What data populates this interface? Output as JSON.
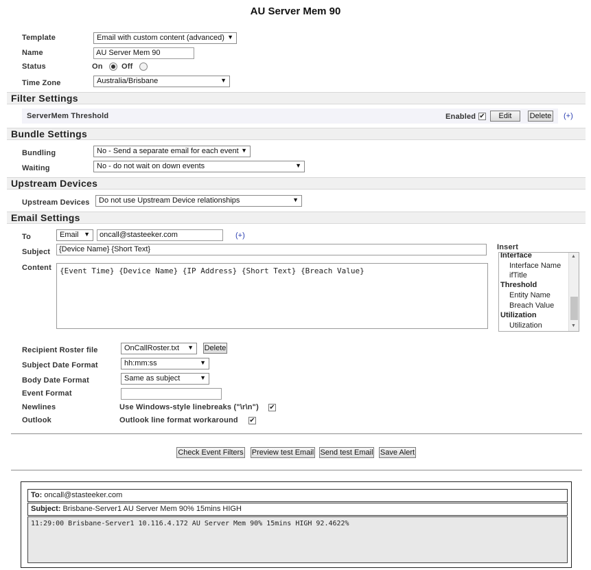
{
  "page_title": "AU Server Mem 90",
  "general": {
    "template_label": "Template",
    "template_value": "Email with custom content (advanced)",
    "name_label": "Name",
    "name_value": "AU Server Mem 90",
    "status_label": "Status",
    "status_on": "On",
    "status_off": "Off",
    "timezone_label": "Time Zone",
    "timezone_value": "Australia/Brisbane"
  },
  "filter_settings": {
    "heading": "Filter Settings",
    "filter_name": "ServerMem Threshold",
    "enabled_label": "Enabled",
    "enabled_mark": "✔",
    "edit_label": "Edit",
    "delete_label": "Delete",
    "add_label": "(+)"
  },
  "bundle_settings": {
    "heading": "Bundle Settings",
    "bundling_label": "Bundling",
    "bundling_value": "No - Send a separate email for each event",
    "waiting_label": "Waiting",
    "waiting_value": "No - do not wait on down events"
  },
  "upstream": {
    "heading": "Upstream Devices",
    "label": "Upstream Devices",
    "value": "Do not use Upstream Device relationships"
  },
  "email_settings": {
    "heading": "Email Settings",
    "to_label": "To",
    "to_type": "Email",
    "to_value": "oncall@stasteeker.com",
    "to_add": "(+)",
    "subject_label": "Subject",
    "subject_value": "{Device Name} {Short Text}",
    "content_label": "Content",
    "content_value": "{Event Time} {Device Name} {IP Address} {Short Text} {Breach Value}",
    "insert_label": "Insert",
    "insert_items": {
      "g1": "Interface",
      "i1": "Interface Name",
      "i2": "ifTitle",
      "g2": "Threshold",
      "i3": "Entity Name",
      "i4": "Breach Value",
      "g3": "Utilization",
      "i5": "Utilization"
    },
    "roster_label": "Recipient Roster file",
    "roster_value": "OnCallRoster.txt",
    "roster_delete": "Delete",
    "subject_date_label": "Subject Date Format",
    "subject_date_value": "hh:mm:ss",
    "body_date_label": "Body Date Format",
    "body_date_value": "Same as subject",
    "event_format_label": "Event Format",
    "event_format_value": "",
    "newlines_label": "Newlines",
    "newlines_text": "Use Windows-style linebreaks (\"\\r\\n\")",
    "newlines_mark": "✔",
    "outlook_label": "Outlook",
    "outlook_text": "Outlook line format workaround",
    "outlook_mark": "✔"
  },
  "actions": {
    "check_filters": "Check Event Filters",
    "preview_email": "Preview test Email",
    "send_email": "Send test Email",
    "save_alert": "Save Alert"
  },
  "preview": {
    "to_label": "To:",
    "to_value": "oncall@stasteeker.com",
    "subject_label": "Subject:",
    "subject_value": "Brisbane-Server1 AU Server Mem 90% 15mins HIGH",
    "body": "11:29:00 Brisbane-Server1 10.116.4.172 AU Server Mem 90% 15mins HIGH 92.4622%"
  },
  "glyphs": {
    "dropdown_arrow": "▼"
  }
}
